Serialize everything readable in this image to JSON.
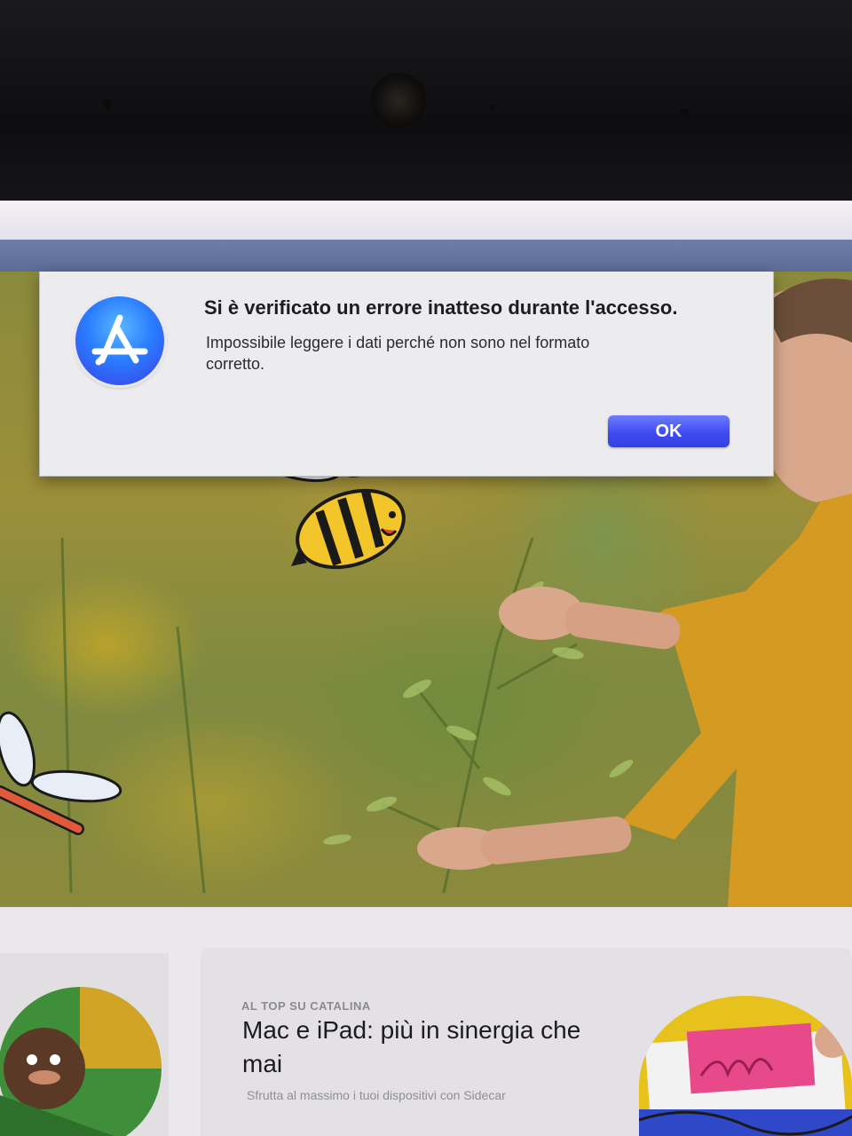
{
  "alert": {
    "title": "Si è verificato un errore inatteso durante l'accesso.",
    "message": "Impossibile leggere i dati perché non sono nel formato corretto.",
    "ok_label": "OK",
    "icon": "app-store-icon"
  },
  "featured": {
    "eyebrow": "AL TOP SU CATALINA",
    "headline": "Mac e iPad: più in sinergia che mai",
    "subtitle": "Sfrutta al massimo i tuoi dispositivi con Sidecar"
  },
  "colors": {
    "accent_button": "#3f4cf2",
    "app_icon_blue": "#2a7dff",
    "band": "#5b6c98"
  }
}
